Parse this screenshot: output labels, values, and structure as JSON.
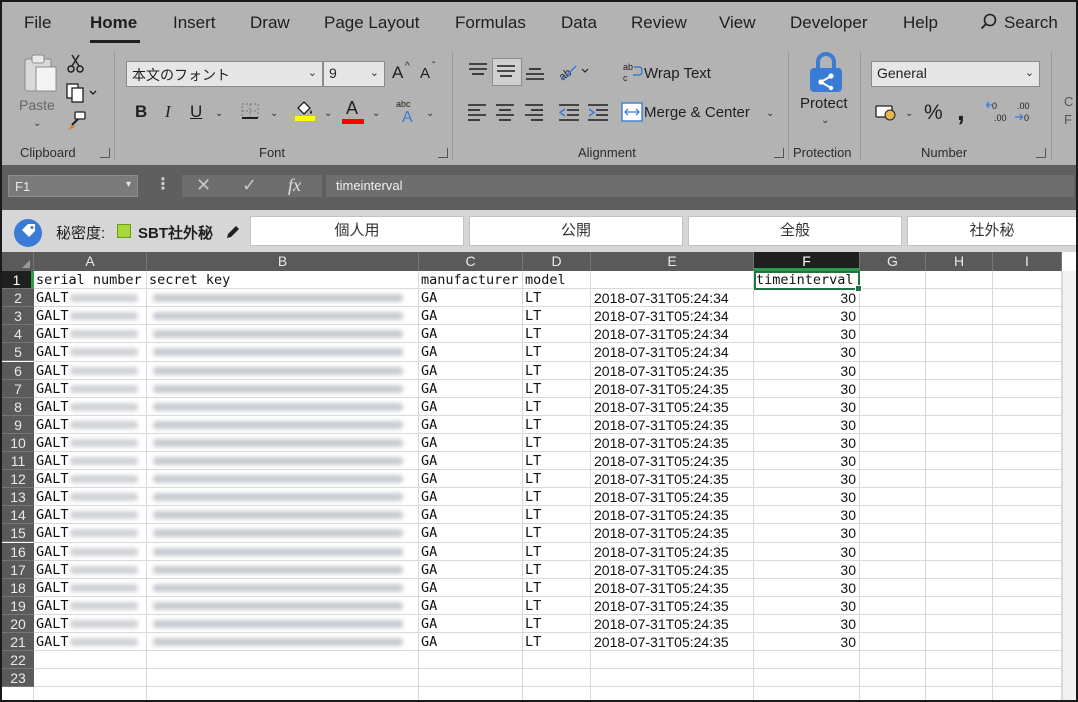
{
  "menu": {
    "tabs": [
      {
        "label": "File"
      },
      {
        "label": "Home"
      },
      {
        "label": "Insert"
      },
      {
        "label": "Draw"
      },
      {
        "label": "Page Layout"
      },
      {
        "label": "Formulas"
      },
      {
        "label": "Data"
      },
      {
        "label": "Review"
      },
      {
        "label": "View"
      },
      {
        "label": "Developer"
      },
      {
        "label": "Help"
      }
    ],
    "active_tab": "Home",
    "search_label": "Search"
  },
  "ribbon": {
    "clipboard": {
      "group_label": "Clipboard",
      "paste_label": "Paste"
    },
    "font": {
      "group_label": "Font",
      "font_name": "本文のフォント",
      "font_size": "9",
      "bold": "B",
      "italic": "I",
      "underline": "U",
      "grow": "A",
      "shrink": "A",
      "font_color_letter": "A",
      "fill_color": "#ffff00",
      "font_color": "#ff0000"
    },
    "alignment": {
      "group_label": "Alignment",
      "wrap_text": "Wrap Text",
      "merge_center": "Merge & Center"
    },
    "protection": {
      "group_label": "Protection",
      "protect": "Protect"
    },
    "number": {
      "group_label": "Number",
      "format": "General",
      "percent": "%",
      "comma": ","
    }
  },
  "formula_bar": {
    "name_box": "F1",
    "fx": "fx",
    "formula": "timeinterval"
  },
  "classification": {
    "label": "秘密度:",
    "current": "SBT社外秘",
    "current_color": "#a6d83a",
    "options": [
      "個人用",
      "公開",
      "全般",
      "社外秘"
    ]
  },
  "sheet": {
    "columns": [
      "A",
      "B",
      "C",
      "D",
      "E",
      "F",
      "G",
      "H",
      "I"
    ],
    "selected_column": "F",
    "selected_cell": "F1",
    "rows": [
      "1",
      "2",
      "3",
      "4",
      "5",
      "6",
      "7",
      "8",
      "9",
      "10",
      "11",
      "12",
      "13",
      "14",
      "15",
      "16",
      "17",
      "18",
      "19",
      "20",
      "21",
      "22",
      "23"
    ],
    "header_row": {
      "A": "serial number",
      "B": "secret key",
      "C": "manufacturer",
      "D": "model",
      "E": "",
      "F": "timeinterval"
    },
    "data_rows": [
      {
        "serial": "GALT",
        "manufacturer": "GA",
        "model": "LT",
        "time": "2018-07-31T05:24:34",
        "interval": "30"
      },
      {
        "serial": "GALT",
        "manufacturer": "GA",
        "model": "LT",
        "time": "2018-07-31T05:24:34",
        "interval": "30"
      },
      {
        "serial": "GALT",
        "manufacturer": "GA",
        "model": "LT",
        "time": "2018-07-31T05:24:34",
        "interval": "30"
      },
      {
        "serial": "GALT",
        "manufacturer": "GA",
        "model": "LT",
        "time": "2018-07-31T05:24:34",
        "interval": "30"
      },
      {
        "serial": "GALT",
        "manufacturer": "GA",
        "model": "LT",
        "time": "2018-07-31T05:24:35",
        "interval": "30"
      },
      {
        "serial": "GALT",
        "manufacturer": "GA",
        "model": "LT",
        "time": "2018-07-31T05:24:35",
        "interval": "30"
      },
      {
        "serial": "GALT",
        "manufacturer": "GA",
        "model": "LT",
        "time": "2018-07-31T05:24:35",
        "interval": "30"
      },
      {
        "serial": "GALT",
        "manufacturer": "GA",
        "model": "LT",
        "time": "2018-07-31T05:24:35",
        "interval": "30"
      },
      {
        "serial": "GALT",
        "manufacturer": "GA",
        "model": "LT",
        "time": "2018-07-31T05:24:35",
        "interval": "30"
      },
      {
        "serial": "GALT",
        "manufacturer": "GA",
        "model": "LT",
        "time": "2018-07-31T05:24:35",
        "interval": "30"
      },
      {
        "serial": "GALT",
        "manufacturer": "GA",
        "model": "LT",
        "time": "2018-07-31T05:24:35",
        "interval": "30"
      },
      {
        "serial": "GALT",
        "manufacturer": "GA",
        "model": "LT",
        "time": "2018-07-31T05:24:35",
        "interval": "30"
      },
      {
        "serial": "GALT",
        "manufacturer": "GA",
        "model": "LT",
        "time": "2018-07-31T05:24:35",
        "interval": "30"
      },
      {
        "serial": "GALT",
        "manufacturer": "GA",
        "model": "LT",
        "time": "2018-07-31T05:24:35",
        "interval": "30"
      },
      {
        "serial": "GALT",
        "manufacturer": "GA",
        "model": "LT",
        "time": "2018-07-31T05:24:35",
        "interval": "30"
      },
      {
        "serial": "GALT",
        "manufacturer": "GA",
        "model": "LT",
        "time": "2018-07-31T05:24:35",
        "interval": "30"
      },
      {
        "serial": "GALT",
        "manufacturer": "GA",
        "model": "LT",
        "time": "2018-07-31T05:24:35",
        "interval": "30"
      },
      {
        "serial": "GALT",
        "manufacturer": "GA",
        "model": "LT",
        "time": "2018-07-31T05:24:35",
        "interval": "30"
      },
      {
        "serial": "GALT",
        "manufacturer": "GA",
        "model": "LT",
        "time": "2018-07-31T05:24:35",
        "interval": "30"
      },
      {
        "serial": "GALT",
        "manufacturer": "GA",
        "model": "LT",
        "time": "2018-07-31T05:24:35",
        "interval": "30"
      }
    ]
  },
  "colors": {
    "accent": "#217346",
    "chrome": "#b3b3b3"
  }
}
